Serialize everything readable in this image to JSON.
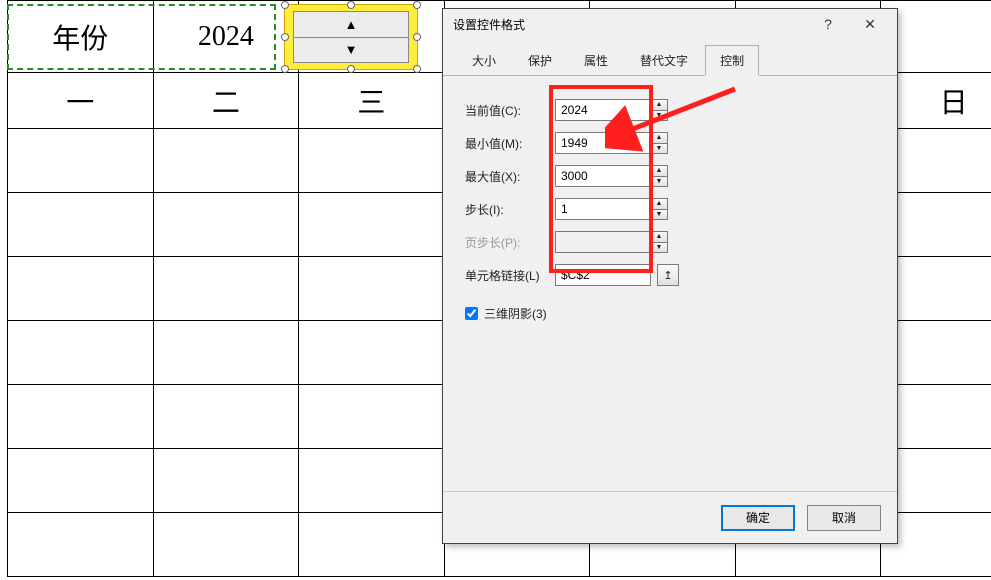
{
  "sheet": {
    "row1": [
      "年份",
      "2024",
      "",
      "",
      "",
      "",
      ""
    ],
    "row2": [
      "一",
      "二",
      "三",
      "",
      "",
      "",
      "日"
    ]
  },
  "dialog": {
    "title": "设置控件格式",
    "help_char": "?",
    "close_char": "✕",
    "tabs": {
      "size": "大小",
      "protect": "保护",
      "props": "属性",
      "alt": "替代文字",
      "control": "控制"
    },
    "fields": {
      "current_lbl": "当前值(C):",
      "current_val": "2024",
      "min_lbl": "最小值(M):",
      "min_val": "1949",
      "max_lbl": "最大值(X):",
      "max_val": "3000",
      "step_lbl": "步长(I):",
      "step_val": "1",
      "pagestep_lbl": "页步长(P):",
      "pagestep_val": "",
      "link_lbl": "单元格链接(L)",
      "link_val": "$C$2",
      "link_btn": "↥"
    },
    "shadow_lbl": "三维阴影(3)",
    "ok": "确定",
    "cancel": "取消"
  },
  "spinner": {
    "up": "▲",
    "down": "▼"
  }
}
